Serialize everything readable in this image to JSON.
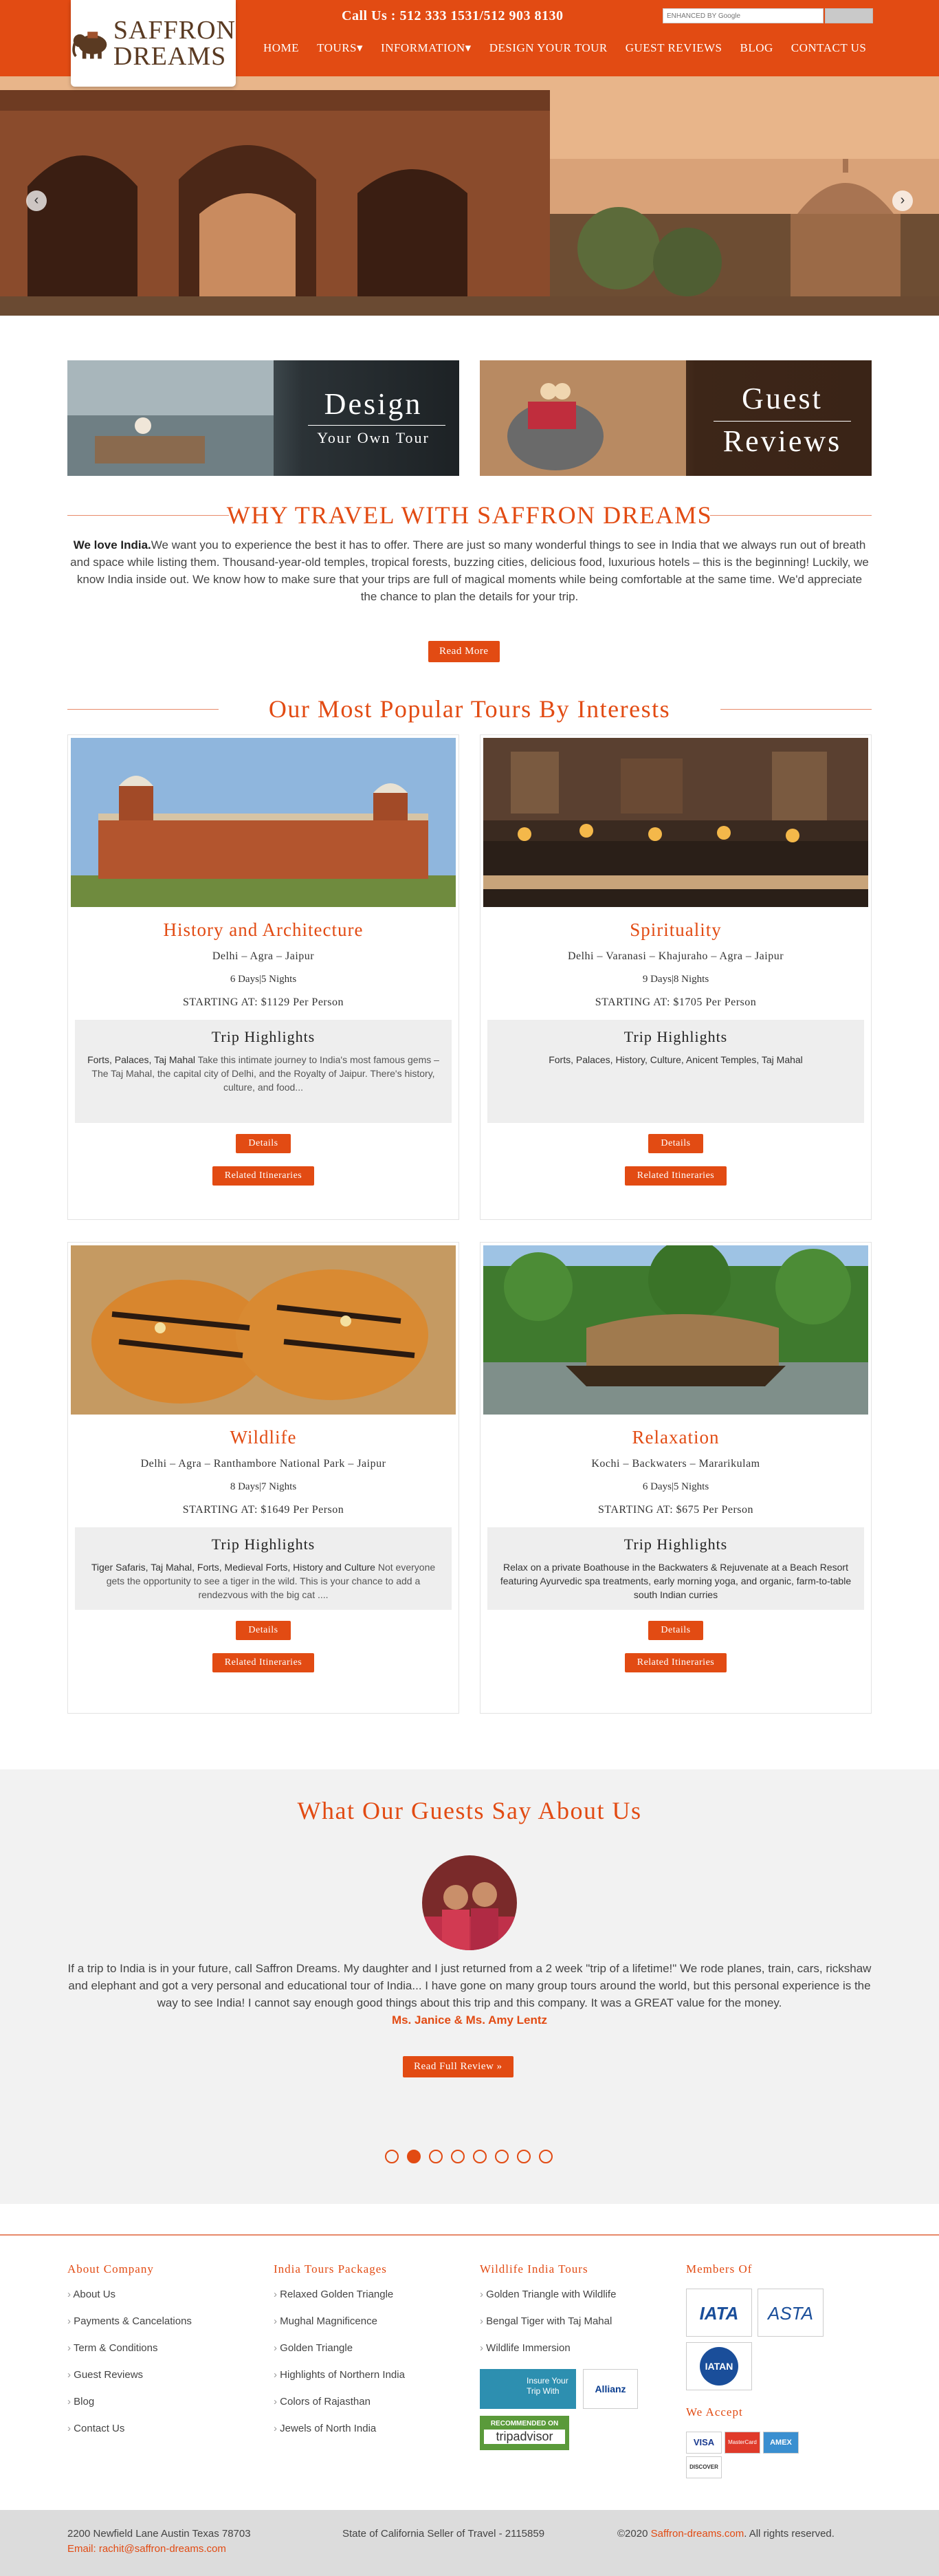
{
  "header": {
    "logo_line1": "SAFFRON",
    "logo_line2": "DREAMS",
    "call_text": "Call Us : 512 333 1531/512 903 8130",
    "search_placeholder": "ENHANCED BY Google",
    "nav": [
      "HOME",
      "TOURS▾",
      "INFORMATION▾",
      "DESIGN YOUR TOUR",
      "GUEST REVIEWS",
      "BLOG",
      "CONTACT US"
    ]
  },
  "promos": {
    "design_l1": "Design",
    "design_l2": "Your Own Tour",
    "guest_l1": "Guest",
    "guest_l2": "Reviews"
  },
  "why": {
    "title": "WHY TRAVEL WITH SAFFRON DREAMS",
    "bold": "We love India.",
    "text": "We want you to experience the best it has to offer. There are just so many wonderful things to see in India that we always run out of breath and space while listing them. Thousand-year-old temples, tropical forests, buzzing cities, delicious food, luxurious hotels – this is the beginning! Luckily, we know India inside out. We know how to make sure that your trips are full of magical moments while being comfortable at the same time. We'd appreciate the chance to plan the details for your trip.",
    "button": "Read More"
  },
  "popular": {
    "title": "Our Most Popular Tours By Interests",
    "highlights_heading": "Trip Highlights",
    "details_button": "Details",
    "related_button": "Related Itineraries",
    "tours": [
      {
        "title": "History and Architecture",
        "route": "Delhi – Agra – Jaipur",
        "days": "6 Days|5 Nights",
        "price": "STARTING AT: $1129 Per Person",
        "hl_bold": "Forts, Palaces, Taj Mahal",
        "hl_desc": " Take this intimate journey to India's most famous gems – The Taj Mahal, the capital city of Delhi, and the Royalty of Jaipur. There's history, culture, and food..."
      },
      {
        "title": "Spirituality",
        "route": "Delhi – Varanasi – Khajuraho – Agra – Jaipur",
        "days": "9 Days|8 Nights",
        "price": "STARTING AT: $1705 Per Person",
        "hl_bold": "Forts, Palaces, History, Culture, Anicent Temples, Taj Mahal",
        "hl_desc": ""
      },
      {
        "title": "Wildlife",
        "route": "Delhi – Agra – Ranthambore National Park – Jaipur",
        "days": "8 Days|7 Nights",
        "price": "STARTING AT: $1649 Per Person",
        "hl_bold": "Tiger Safaris, Taj Mahal, Forts, Medieval Forts, History and Culture",
        "hl_desc": " Not everyone gets the opportunity to see a tiger in the wild. This is your chance to add a rendezvous with the big cat ...."
      },
      {
        "title": "Relaxation",
        "route": "Kochi – Backwaters – Mararikulam",
        "days": "6 Days|5 Nights",
        "price": "STARTING AT: $675 Per Person",
        "hl_bold": "Relax on a private Boathouse in the Backwaters & Rejuvenate at a Beach Resort featuring Ayurvedic spa treatments, early morning yoga, and organic, farm-to-table south Indian curries",
        "hl_desc": ""
      }
    ]
  },
  "testimonial": {
    "title": "What Our Guests Say About Us",
    "text": "If a trip to India is in your future, call Saffron Dreams. My daughter and I just returned from a 2 week \"trip of a lifetime!\" We rode planes, train, cars, rickshaw and elephant and got a very personal and educational tour of India... I have gone on many group tours around the world, but this personal experience is the way to see India! I cannot say enough good things about this trip and this company. It was a GREAT value for the money.",
    "name": "Ms. Janice & Ms. Amy Lentz",
    "button": "Read Full Review »",
    "dots_total": 8,
    "dots_active": 2
  },
  "footer": {
    "about_title": "About Company",
    "about_items": [
      "About Us",
      "Payments & Cancelations",
      "Term & Conditions",
      "Guest Reviews",
      "Blog",
      "Contact Us"
    ],
    "packages_title": "India Tours Packages",
    "packages_items": [
      "Relaxed Golden Triangle",
      "Mughal Magnificence",
      "Golden Triangle",
      "Highlights of Northern India",
      "Colors of Rajasthan",
      "Jewels of North India"
    ],
    "wildlife_title": "Wildlife India Tours",
    "wildlife_items": [
      "Golden Triangle with Wildlife",
      "Bengal Tiger with Taj Mahal",
      "Wildlife Immersion"
    ],
    "insure_text": "Insure Your Trip With",
    "allianz": "Allianz",
    "tripadvisor_top": "RECOMMENDED ON",
    "tripadvisor": "tripadvisor",
    "members_title": "Members Of",
    "iata": "IATA",
    "asta": "ASTA",
    "iatan": "IATAN",
    "accept_title": "We Accept",
    "cards": [
      "VISA",
      "MasterCard",
      "AMEX",
      "DISCOVER"
    ]
  },
  "bottom": {
    "address": "2200 Newfield Lane Austin Texas 78703",
    "email": "Email: rachit@saffron-dreams.com",
    "seller": "State of California Seller of Travel - 2115859",
    "copy_pre": "©2020 ",
    "copy_site": "Saffron-dreams.com",
    "copy_post": ". All rights reserved."
  },
  "colors": {
    "accent": "#e24b13",
    "footer_bar": "#dcdcdc",
    "testimonial_bg": "#f2f2f2"
  }
}
